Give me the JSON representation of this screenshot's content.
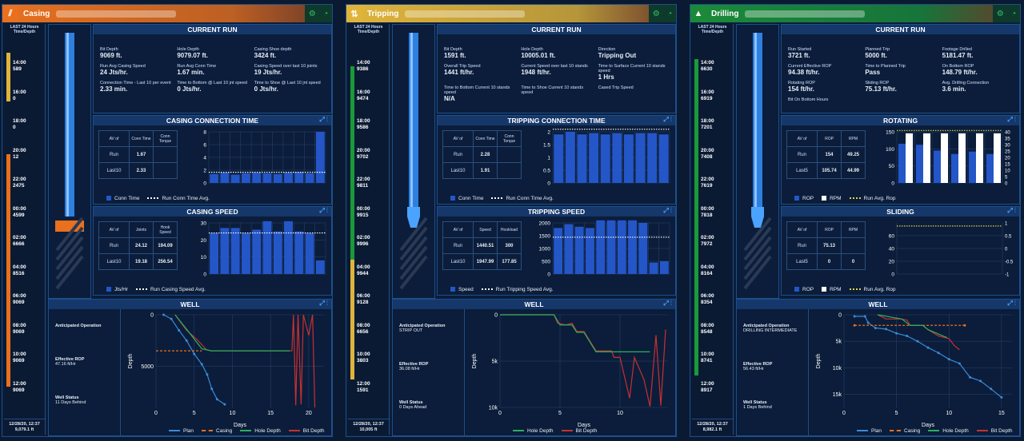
{
  "dashboards": [
    {
      "title": "Casing",
      "color": "#e8701e",
      "icon": "casing-icon",
      "time": {
        "label": "LAST 24 Hours Time/Depth",
        "ticks": [
          [
            "14:00",
            "589"
          ],
          [
            "16:00",
            "0"
          ],
          [
            "18:00",
            "0"
          ],
          [
            "20:00",
            "12"
          ],
          [
            "22:00",
            "2475"
          ],
          [
            "00:00",
            "4599"
          ],
          [
            "02:00",
            "6666"
          ],
          [
            "04:00",
            "8516"
          ],
          [
            "06:00",
            "9069"
          ],
          [
            "08:00",
            "9069"
          ],
          [
            "10:00",
            "9069"
          ],
          [
            "12:00",
            "9069"
          ]
        ],
        "footer": [
          "12/28/20, 12:37",
          "9,079.1 ft"
        ]
      },
      "current_run": {
        "title": "CURRENT RUN",
        "items": [
          [
            "Bit Depth",
            "9069 ft."
          ],
          [
            "Hole Depth",
            "9079.07 ft."
          ],
          [
            "Casing Shoe depth",
            "3424 ft."
          ],
          [
            "Run Avg Casing Speed",
            "24 Jts/hr."
          ],
          [
            "Run Avg Conn Time",
            "1.67 min."
          ],
          [
            "Casing Speed over last 10 joints",
            "19 Jts/hr."
          ],
          [
            "Connection Time - Last 10 per event",
            "2.33 min."
          ],
          [
            "Time to Bottom @ Last 10 jnt speed",
            "0 Jts/hr."
          ],
          [
            "Time to Shoe @ Last 10 jnt speed",
            "0 Jts/hr."
          ]
        ]
      },
      "p1": {
        "title": "CASING CONNECTION TIME",
        "cols": [
          "AV of",
          "Conn Time",
          "Conn Torque"
        ],
        "rows": [
          [
            "Run",
            "1.67",
            ""
          ],
          [
            "Last10",
            "2.33",
            ""
          ]
        ],
        "legend": [
          "Conn Time",
          "Run Conn Time Avg."
        ]
      },
      "p2": {
        "title": "CASING SPEED",
        "cols": [
          "AV of",
          "Joints",
          "Hook Speed"
        ],
        "rows": [
          [
            "Run",
            "24.12",
            "194.09"
          ],
          [
            "Last10",
            "19.18",
            "256.54"
          ]
        ],
        "legend": [
          "Jts/Hr",
          "Run Casing Speed Avg."
        ]
      },
      "well": {
        "title": "WELL",
        "info": [
          [
            "Anticipated Operation",
            ""
          ],
          [
            "Effective ROP",
            "47.16 ft/Hr"
          ],
          [
            "Well Status",
            "11 Days Behind"
          ]
        ],
        "legend": [
          "Plan",
          "Casing",
          "Hole Depth",
          "Bit Depth"
        ],
        "xlabel": "Days",
        "ylabel": "Depth"
      }
    },
    {
      "title": "Tripping",
      "color": "#e0b43a",
      "icon": "tripping-icon",
      "time": {
        "label": "LAST 24 Hours Time/Depth",
        "ticks": [
          [
            "14:00",
            "9386"
          ],
          [
            "16:00",
            "9474"
          ],
          [
            "18:00",
            "9586"
          ],
          [
            "20:00",
            "9702"
          ],
          [
            "22:00",
            "9811"
          ],
          [
            "00:00",
            "9915"
          ],
          [
            "02:00",
            "9996"
          ],
          [
            "04:00",
            "9944"
          ],
          [
            "06:00",
            "9128"
          ],
          [
            "08:00",
            "6656"
          ],
          [
            "10:00",
            "3803"
          ],
          [
            "12:00",
            "1591"
          ]
        ],
        "footer": [
          "12/28/20, 12:37",
          "10,005 ft"
        ]
      },
      "current_run": {
        "title": "CURRENT RUN",
        "items": [
          [
            "Bit Depth",
            "1591 ft."
          ],
          [
            "Hole Depth",
            "10005.01 ft."
          ],
          [
            "Direction",
            "Tripping Out"
          ],
          [
            "Overall Trip Speed",
            "1441 ft/hr."
          ],
          [
            "Current Speed over last 10 stands",
            "1948 ft/hr."
          ],
          [
            "Time to Surface Current 10 stands speed",
            "1 Hrs"
          ],
          [
            "Time to Bottom Current 10 stands speed",
            "N/A"
          ],
          [
            "Time to Shoe Current 10 stands speed",
            ""
          ],
          [
            "Cased Trip Speed",
            ""
          ]
        ]
      },
      "p1": {
        "title": "TRIPPING CONNECTION TIME",
        "cols": [
          "AV of",
          "Conn Time",
          "Conn Torque"
        ],
        "rows": [
          [
            "Run",
            "2.28",
            ""
          ],
          [
            "Last10",
            "1.91",
            ""
          ]
        ],
        "legend": [
          "Conn Time",
          "Run Conn Time Avg."
        ]
      },
      "p2": {
        "title": "TRIPPING SPEED",
        "cols": [
          "AV of",
          "Speed",
          "Hookload"
        ],
        "rows": [
          [
            "Run",
            "1440.51",
            "300"
          ],
          [
            "Last10",
            "1947.99",
            "177.85"
          ]
        ],
        "legend": [
          "Speed",
          "Run Tripping Speed Avg."
        ]
      },
      "well": {
        "title": "WELL",
        "info": [
          [
            "Anticipated Operation",
            "STRIP OUT"
          ],
          [
            "Effective ROP",
            "36.08 ft/Hr"
          ],
          [
            "Well Status",
            "0 Days Ahead"
          ]
        ],
        "legend": [
          "Hole Depth",
          "Bit Depth"
        ],
        "xlabel": "Days",
        "ylabel": "Depth"
      }
    },
    {
      "title": "Drilling",
      "color": "#1a8a3a",
      "icon": "drilling-icon",
      "time": {
        "label": "LAST 24 Hours Time/Depth",
        "ticks": [
          [
            "14:00",
            "6630"
          ],
          [
            "16:00",
            "6919"
          ],
          [
            "18:00",
            "7201"
          ],
          [
            "20:00",
            "7408"
          ],
          [
            "22:00",
            "7619"
          ],
          [
            "00:00",
            "7818"
          ],
          [
            "02:00",
            "7972"
          ],
          [
            "04:00",
            "8164"
          ],
          [
            "06:00",
            "8354"
          ],
          [
            "08:00",
            "8548"
          ],
          [
            "10:00",
            "8741"
          ],
          [
            "12:00",
            "8917"
          ]
        ],
        "footer": [
          "12/28/20, 12:37",
          "8,982.1 ft"
        ]
      },
      "current_run": {
        "title": "CURRENT RUN",
        "items": [
          [
            "Run Started",
            "3721 ft."
          ],
          [
            "Planned Trip",
            "5000 ft."
          ],
          [
            "Footage Drilled",
            "5181.47 ft."
          ],
          [
            "Current Effective ROP",
            "94.38 ft/hr."
          ],
          [
            "Time to Planned Trip",
            "Pass"
          ],
          [
            "On Bottom ROP",
            "148.79 ft/hr."
          ],
          [
            "Rotating ROP",
            "154 ft/hr."
          ],
          [
            "Sliding ROP",
            "75.13 ft/hr."
          ],
          [
            "Avg. Drilling Connection",
            "3.6 min."
          ],
          [
            "Bit On Bottom Hours",
            ""
          ]
        ]
      },
      "p1": {
        "title": "ROTATING",
        "cols": [
          "AV of",
          "ROP",
          "RPM"
        ],
        "rows": [
          [
            "Run",
            "154",
            "49.25"
          ],
          [
            "Last5",
            "105.74",
            "44.99"
          ]
        ],
        "legend": [
          "ROP",
          "RPM",
          "Run Avg. Rop"
        ]
      },
      "p2": {
        "title": "SLIDING",
        "cols": [
          "AV of",
          "ROP",
          "RPM"
        ],
        "rows": [
          [
            "Run",
            "75.13",
            ""
          ],
          [
            "Last5",
            "0",
            "0"
          ]
        ],
        "legend": [
          "ROP",
          "RPM",
          "Run Avg. Rop"
        ]
      },
      "well": {
        "title": "WELL",
        "info": [
          [
            "Anticipated Operation",
            "DRILLING INTERMEDIATE"
          ],
          [
            "Effective ROP",
            "56.43 ft/Hr"
          ],
          [
            "Well Status",
            "1 Days Behind"
          ]
        ],
        "legend": [
          "Plan",
          "Casing",
          "Hole Depth",
          "Bit Depth"
        ],
        "xlabel": "Days",
        "ylabel": "Depth"
      }
    }
  ],
  "chart_data": [
    {
      "type": "bar",
      "title": "CASING CONNECTION TIME",
      "series": [
        {
          "name": "Conn Time",
          "values": [
            1.4,
            1.6,
            1.3,
            1.5,
            1.6,
            1.5,
            1.4,
            1.6,
            1.7,
            1.5,
            8
          ]
        }
      ],
      "avg": 1.67,
      "ylim": [
        0,
        8
      ],
      "yticks": [
        0,
        2,
        4,
        6,
        8
      ]
    },
    {
      "type": "bar",
      "title": "CASING SPEED",
      "series": [
        {
          "name": "Jts/Hr",
          "values": [
            24,
            27,
            27,
            24,
            26,
            31,
            25,
            31,
            25,
            24,
            8
          ]
        }
      ],
      "avg": 24.12,
      "ylim": [
        0,
        30
      ],
      "yticks": [
        0,
        10,
        20,
        30
      ]
    },
    {
      "type": "bar",
      "title": "TRIPPING CONNECTION TIME",
      "series": [
        {
          "name": "Conn Time",
          "values": [
            1.9,
            2.0,
            1.9,
            1.95,
            1.9,
            1.95,
            1.9,
            1.95,
            1.95,
            1.9
          ]
        }
      ],
      "avg": 2.28,
      "ylim": [
        0,
        2
      ],
      "yticks": [
        0,
        0.5,
        1,
        1.5,
        2
      ]
    },
    {
      "type": "bar",
      "title": "TRIPPING SPEED",
      "series": [
        {
          "name": "Speed",
          "values": [
            1800,
            1950,
            1850,
            1800,
            2250,
            2300,
            2150,
            2250,
            2000,
            450,
            500
          ]
        }
      ],
      "avg": 1440,
      "ylim": [
        0,
        2000
      ],
      "yticks": [
        0,
        500,
        1000,
        1500,
        2000
      ]
    },
    {
      "type": "bar",
      "title": "ROTATING",
      "series": [
        {
          "name": "ROP",
          "values": [
            115,
            112,
            95,
            85,
            92,
            85
          ]
        },
        {
          "name": "RPM",
          "values": [
            40,
            40,
            40,
            40,
            40,
            40
          ]
        }
      ],
      "avg": 154,
      "ylim": [
        0,
        150
      ],
      "yticks": [
        0,
        50,
        100,
        150
      ],
      "y2ticks": [
        0,
        5,
        10,
        15,
        20,
        25,
        30,
        35,
        40
      ]
    },
    {
      "type": "bar",
      "title": "SLIDING",
      "series": [
        {
          "name": "ROP",
          "values": []
        }
      ],
      "avg": 75.13,
      "ylim": [
        0,
        80
      ],
      "yticks": [
        0,
        20,
        40,
        60
      ],
      "y2ticks": [
        -1,
        -0.5,
        0,
        0.5,
        1
      ]
    }
  ]
}
